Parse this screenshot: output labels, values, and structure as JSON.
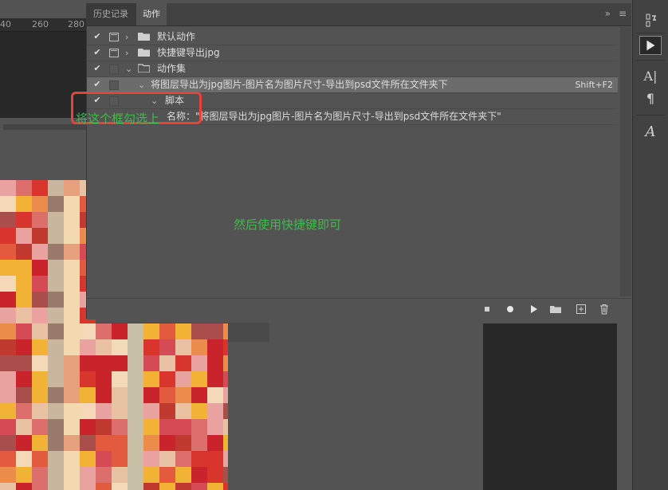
{
  "ruler": {
    "ticks": [
      "40",
      "260",
      "280"
    ]
  },
  "panel": {
    "tabs": {
      "history": "历史记录",
      "actions": "动作"
    },
    "expand_glyph": "»",
    "menu_glyph": "≡"
  },
  "rows": [
    {
      "check": "✔",
      "label": "默认动作"
    },
    {
      "check": "✔",
      "label": "快捷键导出jpg"
    },
    {
      "check": "✔",
      "label": "动作集"
    },
    {
      "check": "✔",
      "label": "将图层导出为jpg图片-图片名为图片尺寸-导出到psd文件所在文件夹下",
      "shortcut": "Shift+F2"
    },
    {
      "check": "✔",
      "label": "脚本"
    },
    {
      "label": "名称：\"将图层导出为jpg图片-图片名为图片尺寸-导出到psd文件所在文件夹下\""
    }
  ],
  "annotations": {
    "box_label": "将这个框勾选上",
    "instruction": "然后使用快捷键即可"
  },
  "bottom_bar_icons": [
    "stop-icon",
    "record-icon",
    "play-icon",
    "new-set-icon",
    "new-action-icon",
    "delete-icon"
  ],
  "toolbar_icons": [
    "history-icon",
    "actions-play-icon",
    "character-icon",
    "paragraph-icon",
    "glyphs-icon"
  ],
  "toolbar_glyphs": {
    "char": "A|",
    "para": "¶",
    "glyph": "A"
  },
  "colors": {
    "annotation_red": "#e5443a",
    "annotation_green": "#43b84b",
    "panel_bg": "#535353",
    "selected_row": "#6c6c6c"
  }
}
